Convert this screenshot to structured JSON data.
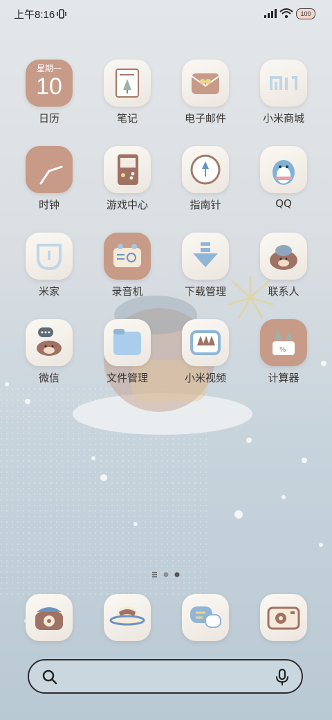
{
  "status_bar": {
    "time": "上午8:16",
    "battery": "100"
  },
  "apps": [
    {
      "label": "日历",
      "icon": "calendar-icon",
      "weekday": "星期一",
      "day": "10"
    },
    {
      "label": "笔记",
      "icon": "notes-icon"
    },
    {
      "label": "电子邮件",
      "icon": "mail-icon"
    },
    {
      "label": "小米商城",
      "icon": "mi-store-icon"
    },
    {
      "label": "时钟",
      "icon": "clock-icon"
    },
    {
      "label": "游戏中心",
      "icon": "game-center-icon"
    },
    {
      "label": "指南针",
      "icon": "compass-icon"
    },
    {
      "label": "QQ",
      "icon": "qq-penguin-icon"
    },
    {
      "label": "米家",
      "icon": "mijia-icon"
    },
    {
      "label": "录音机",
      "icon": "recorder-icon"
    },
    {
      "label": "下载管理",
      "icon": "download-icon"
    },
    {
      "label": "联系人",
      "icon": "contacts-icon"
    },
    {
      "label": "微信",
      "icon": "wechat-icon"
    },
    {
      "label": "文件管理",
      "icon": "file-manager-icon"
    },
    {
      "label": "小米视频",
      "icon": "mi-video-icon"
    },
    {
      "label": "计算器",
      "icon": "calculator-icon"
    }
  ],
  "page_indicator": {
    "pages": 2,
    "current": 2
  },
  "dock": [
    {
      "icon": "phone-icon"
    },
    {
      "icon": "browser-planet-icon"
    },
    {
      "icon": "messages-icon"
    },
    {
      "icon": "camera-icon"
    }
  ],
  "search": {
    "placeholder": ""
  },
  "colors": {
    "accent_brown": "#c79b87",
    "light_tile": "#f6f1ea",
    "text": "#3a3533"
  }
}
